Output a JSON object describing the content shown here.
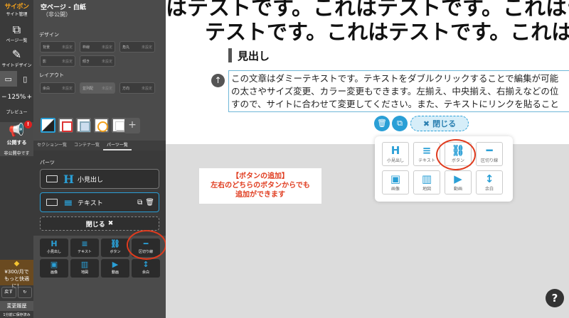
{
  "rail": {
    "logo_brand": "サイポン",
    "logo_sub": "サイト管理",
    "page_list": "ページ一覧",
    "site_design": "サイトデザイン",
    "zoom_minus": "−",
    "zoom_value": "125%",
    "zoom_plus": "+",
    "preview": "プレビュー",
    "publish": "公開する",
    "publish_badge": "!",
    "private_note": "非公開中です",
    "upgrade_line1": "¥300/月で",
    "upgrade_line2": "もっと快適に！",
    "undo": "戻す",
    "redo": "↻",
    "history": "変更履歴",
    "autosave": "1分前に保存済み"
  },
  "panel": {
    "page_title": "空ページ - 白紙",
    "page_state": "（非公開）",
    "design_label": "デザイン",
    "design_props": [
      {
        "label": "背景",
        "value": "未設定"
      },
      {
        "label": "枠線",
        "value": "未設定"
      },
      {
        "label": "角丸",
        "value": "未設定"
      },
      {
        "label": "影",
        "value": "未設定"
      },
      {
        "label": "傾き",
        "value": "未設定"
      }
    ],
    "layout_label": "レイアウト",
    "layout_props": [
      {
        "label": "余白",
        "value": "未設定"
      },
      {
        "label": "並列配",
        "value": "未設定"
      },
      {
        "label": "方向",
        "value": "未設定"
      }
    ],
    "tabs": [
      "セクション一覧",
      "コンテナ一覧",
      "パーツ一覧"
    ],
    "parts_label": "パーツ",
    "blocks": [
      {
        "icon": "H",
        "label": "小見出し"
      },
      {
        "icon": "≡",
        "label": "テキスト"
      }
    ],
    "close_label": "閉じる",
    "close_icon": "✖",
    "mini_parts": [
      {
        "icon": "H",
        "label": "小見出し"
      },
      {
        "icon": "≡",
        "label": "テキスト"
      },
      {
        "icon": "⛓",
        "label": "ボタン"
      },
      {
        "icon": "━",
        "label": "区切り線"
      },
      {
        "icon": "▣",
        "label": "画像"
      },
      {
        "icon": "▥",
        "label": "地図"
      },
      {
        "icon": "▶",
        "label": "動画"
      },
      {
        "icon": "↕",
        "label": "余白"
      }
    ]
  },
  "canvas": {
    "big_line1": "はテストです。これはテストです。これはテス",
    "big_line2": "テストです。これはテストです。これはテ",
    "heading": "見出し",
    "body_lines": [
      "この文章はダミーテキストです。テキストをダブルクリックすることで編集が可能",
      "の太さやサイズ変更、カラー変更もできます。左揃え、中央揃え、右揃えなどの位",
      "すので、サイトに合わせて変更してください。また、テキストにリンクを貼ること"
    ],
    "close_label": "閉じる",
    "close_icon": "✖",
    "popup_parts": [
      {
        "icon": "H",
        "label": "小見出し"
      },
      {
        "icon": "≡",
        "label": "テキスト"
      },
      {
        "icon": "⛓",
        "label": "ボタン"
      },
      {
        "icon": "━",
        "label": "区切り線"
      },
      {
        "icon": "▣",
        "label": "画像"
      },
      {
        "icon": "▥",
        "label": "地図"
      },
      {
        "icon": "▶",
        "label": "動画"
      },
      {
        "icon": "↕",
        "label": "余白"
      }
    ],
    "note_line1": "【ボタンの追加】",
    "note_line2": "左右のどちらのボタンからでも",
    "note_line3": "追加ができます",
    "help": "?"
  },
  "colors": {
    "accent": "#2a9fd6",
    "annotation": "#e03b1e",
    "brand": "#f4a21c"
  }
}
